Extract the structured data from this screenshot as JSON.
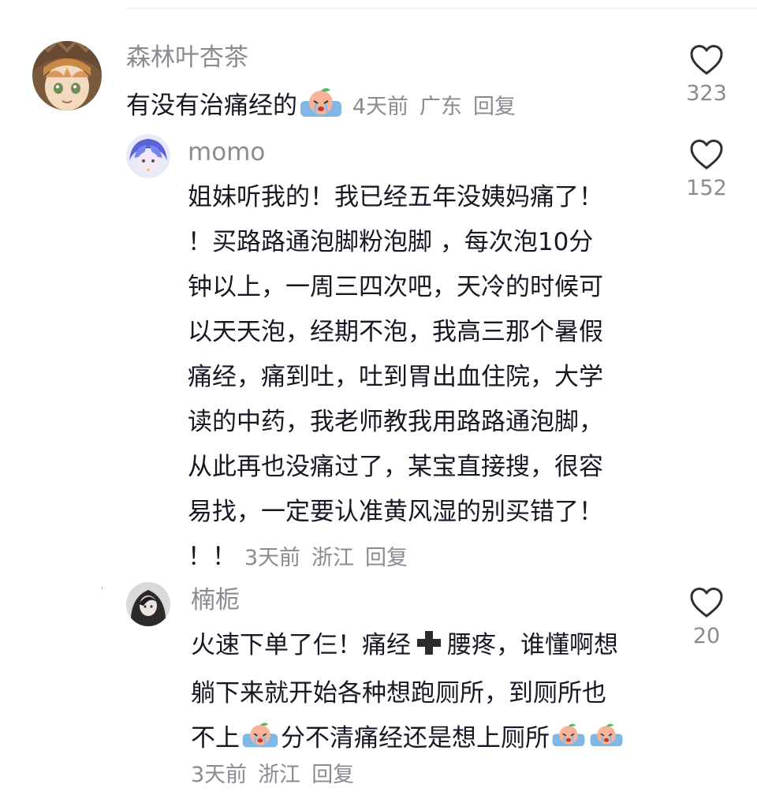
{
  "comments": [
    {
      "author": "森林叶杏茶",
      "text": "有没有治痛经的",
      "meta": {
        "time": "4天前",
        "location": "广东",
        "reply": "回复"
      },
      "likes": "323",
      "avatar_icon": "anime-boy-avatar"
    },
    {
      "author": "momo",
      "lines": [
        "姐妹听我的！我已经五年没姨妈痛了！",
        "！买路路通泡脚粉泡脚 ，每次泡10分",
        "钟以上，一周三四次吧，天冷的时候可",
        "以天天泡，经期不泡，我高三那个暑假",
        "痛经，痛到吐，吐到胃出血住院，大学",
        "读的中药，我老师教我用路路通泡脚，",
        "从此再也没痛过了，某宝直接搜，很容",
        "易找，一定要认准黄风湿的别买错了！",
        "！！"
      ],
      "meta": {
        "time": "3天前",
        "location": "浙江",
        "reply": "回复"
      },
      "likes": "152",
      "avatar_icon": "blue-character-avatar"
    },
    {
      "author": "楠栀",
      "line1_a": "火速下单了仨！痛经",
      "line1_b": "腰疼，谁懂啊想",
      "line2": "躺下来就开始各种想跑厕所，到厕所也",
      "line3_a": "不上",
      "line3_b": "分不清痛经还是想上厕所",
      "meta": {
        "time": "3天前",
        "location": "浙江",
        "reply": "回复"
      },
      "likes": "20",
      "avatar_icon": "dark-hair-girl-avatar"
    }
  ],
  "icons": {
    "like": "heart-outline-icon",
    "emoji": "crying-peach-emoji",
    "plus": "heavy-plus-icon"
  },
  "colors": {
    "text": "#161823",
    "secondary": "#8a8b91",
    "heart": "#2f2f35"
  }
}
